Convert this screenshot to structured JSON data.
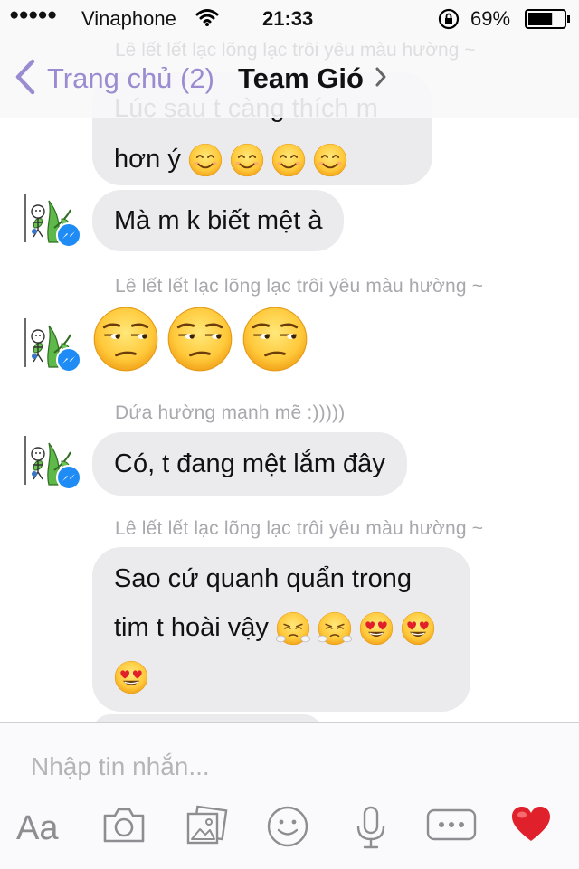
{
  "status_bar": {
    "signal_dots": "●●●●●",
    "carrier": "Vinaphone",
    "time": "21:33",
    "battery_percent": "69%",
    "battery_level": 0.69
  },
  "nav": {
    "back_label": "Trang chủ (2)",
    "title": "Team Gió",
    "sender_peek": "Lê lết lết lạc lõng lạc trôi yêu màu hường ~",
    "message_peek": "Lúc sau t càng thích m"
  },
  "messages": [
    {
      "text": "hơn ý",
      "emojis": [
        "smile",
        "smile",
        "smile",
        "smile"
      ]
    },
    {
      "text": "Mà m k biết mệt à"
    },
    {
      "sender": "Lê lết lết lạc lõng lạc trôi yêu màu hường ~",
      "emojis": [
        "unamused",
        "unamused",
        "unamused"
      ]
    },
    {
      "sender": "Dứa hường mạnh mẽ  :)))))",
      "text": "Có, t đang mệt lắm đây"
    },
    {
      "sender": "Lê lết lết lạc lõng lạc trôi yêu màu hường ~",
      "line1": "Sao cứ quanh quẩn trong",
      "line2": "tim t hoài vậy",
      "emojis": [
        "steam",
        "steam",
        "heart_eyes",
        "heart_eyes",
        "heart_eyes"
      ]
    }
  ],
  "composer": {
    "placeholder": "Nhập tin nhắn...",
    "text_tool_label": "Aa",
    "icons": [
      "text-format-icon",
      "camera-icon",
      "gallery-icon",
      "emoji-icon",
      "microphone-icon",
      "more-icon",
      "heart-icon"
    ]
  },
  "colors": {
    "accent": "#9b8bd0",
    "bubble": "#ebebee",
    "messenger_badge": "#1f8cf5",
    "heart": "#e0202a"
  }
}
